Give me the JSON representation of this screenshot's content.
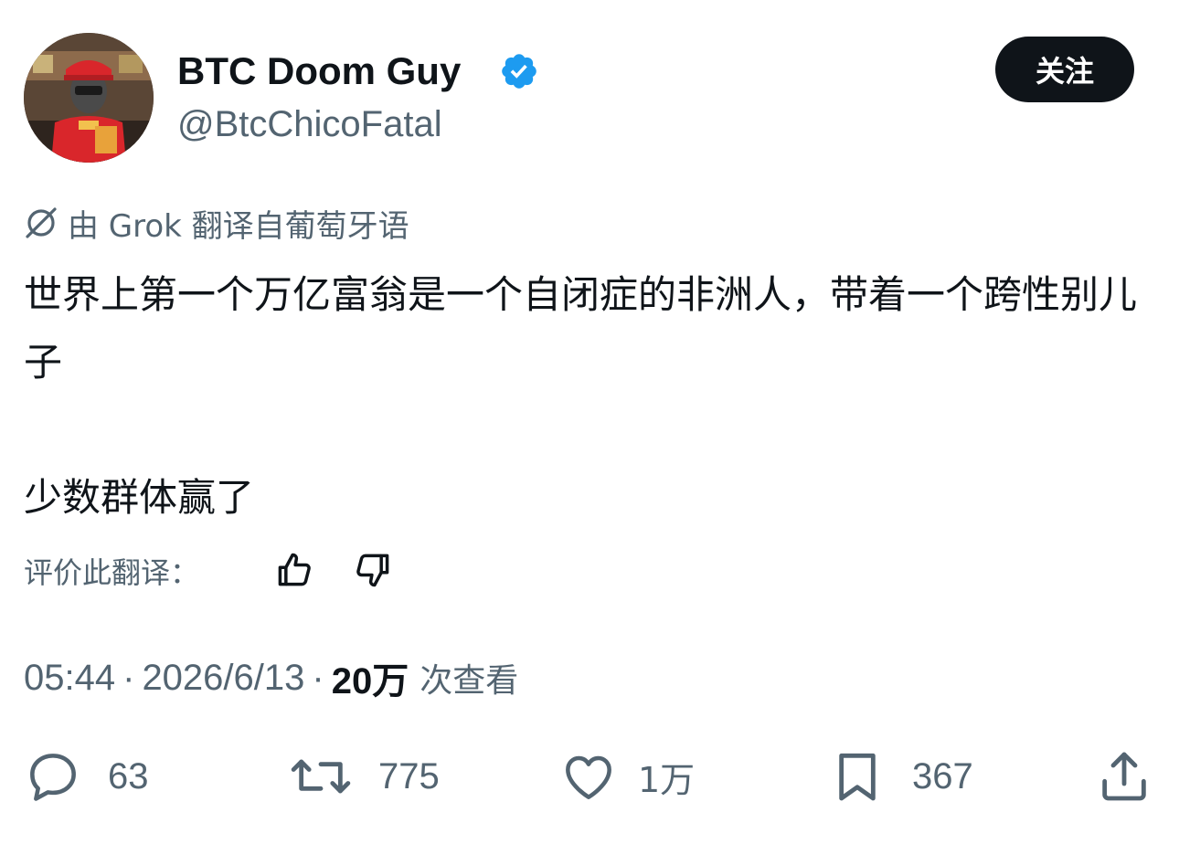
{
  "author": {
    "display_name": "BTC Doom Guy",
    "handle": "@BtcChicoFatal",
    "verified": true
  },
  "follow_button": {
    "label": "关注"
  },
  "translation": {
    "label": "由 Grok 翻译自葡萄牙语",
    "icon": "translate-globe-icon"
  },
  "tweet": {
    "paragraph_1": "世界上第一个万亿富翁是一个自闭症的非洲人，带着一个跨性别儿子",
    "paragraph_2": "少数群体赢了"
  },
  "rate_translation": {
    "label": "评价此翻译：",
    "thumbs_up_icon": "thumbs-up-icon",
    "thumbs_down_icon": "thumbs-down-icon"
  },
  "meta": {
    "time": "05:44",
    "date": "2026/6/13",
    "separator": "·",
    "views_count": "20万",
    "views_label": "次查看"
  },
  "actions": {
    "reply": {
      "icon": "reply-bubble-icon",
      "count": "63"
    },
    "retweet": {
      "icon": "retweet-icon",
      "count": "775"
    },
    "like": {
      "icon": "heart-icon",
      "count": "1万"
    },
    "bookmark": {
      "icon": "bookmark-icon",
      "count": "367"
    },
    "share": {
      "icon": "share-upload-icon"
    }
  },
  "colors": {
    "text_primary": "#0f1419",
    "text_secondary": "#536471",
    "verified_blue": "#1d9bf0",
    "follow_button_bg": "#0f1419"
  }
}
